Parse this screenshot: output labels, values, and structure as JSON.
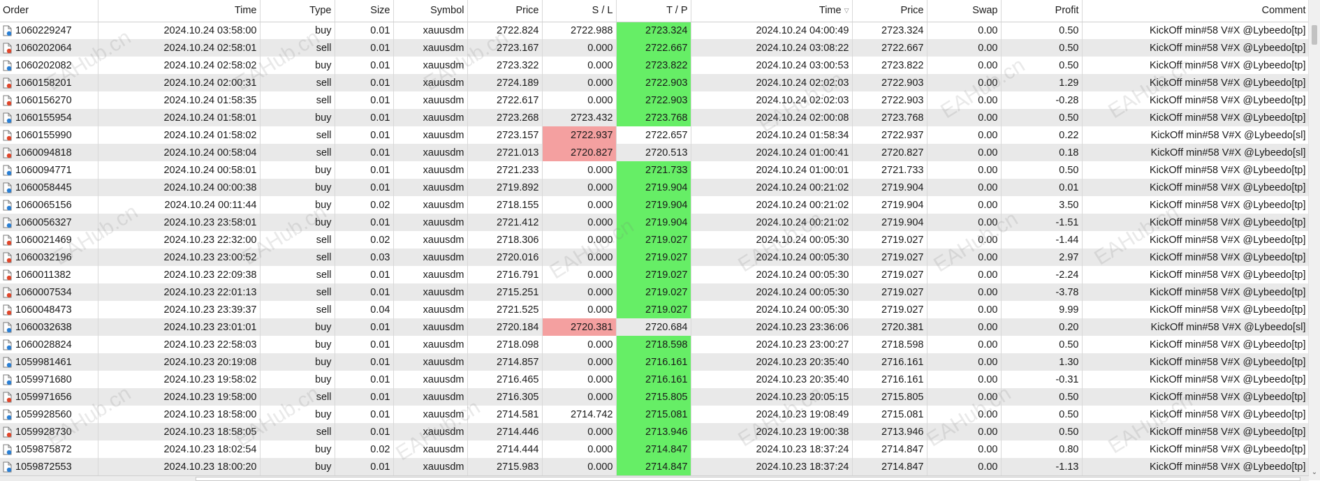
{
  "columns": [
    "Order",
    "Time",
    "Type",
    "Size",
    "Symbol",
    "Price",
    "S / L",
    "T / P",
    "Time",
    "Price",
    "Swap",
    "Profit",
    "Comment"
  ],
  "watermark_text": "EAHub.cn",
  "colors": {
    "tp_hit": "#66ee66",
    "sl_hit": "#f4a0a0",
    "row_alt": "#e9e9e9",
    "icon_buy": "#2a7fd4",
    "icon_sell": "#e0462b"
  },
  "rows": [
    {
      "order": "1060229247",
      "open_time": "2024.10.24 03:58:00",
      "type": "buy",
      "size": "0.01",
      "symbol": "xauusdm",
      "open_price": "2722.824",
      "sl": "2722.988",
      "tp": "2723.324",
      "close_time": "2024.10.24 04:00:49",
      "close_price": "2723.324",
      "swap": "0.00",
      "profit": "0.50",
      "comment": "KickOff min#58 V#X @Lybeedo[tp]",
      "hit": "tp"
    },
    {
      "order": "1060202064",
      "open_time": "2024.10.24 02:58:01",
      "type": "sell",
      "size": "0.01",
      "symbol": "xauusdm",
      "open_price": "2723.167",
      "sl": "0.000",
      "tp": "2722.667",
      "close_time": "2024.10.24 03:08:22",
      "close_price": "2722.667",
      "swap": "0.00",
      "profit": "0.50",
      "comment": "KickOff min#58 V#X @Lybeedo[tp]",
      "hit": "tp"
    },
    {
      "order": "1060202082",
      "open_time": "2024.10.24 02:58:02",
      "type": "buy",
      "size": "0.01",
      "symbol": "xauusdm",
      "open_price": "2723.322",
      "sl": "0.000",
      "tp": "2723.822",
      "close_time": "2024.10.24 03:00:53",
      "close_price": "2723.822",
      "swap": "0.00",
      "profit": "0.50",
      "comment": "KickOff min#58 V#X @Lybeedo[tp]",
      "hit": "tp"
    },
    {
      "order": "1060158201",
      "open_time": "2024.10.24 02:00:31",
      "type": "sell",
      "size": "0.01",
      "symbol": "xauusdm",
      "open_price": "2724.189",
      "sl": "0.000",
      "tp": "2722.903",
      "close_time": "2024.10.24 02:02:03",
      "close_price": "2722.903",
      "swap": "0.00",
      "profit": "1.29",
      "comment": "KickOff min#58 V#X @Lybeedo[tp]",
      "hit": "tp"
    },
    {
      "order": "1060156270",
      "open_time": "2024.10.24 01:58:35",
      "type": "sell",
      "size": "0.01",
      "symbol": "xauusdm",
      "open_price": "2722.617",
      "sl": "0.000",
      "tp": "2722.903",
      "close_time": "2024.10.24 02:02:03",
      "close_price": "2722.903",
      "swap": "0.00",
      "profit": "-0.28",
      "comment": "KickOff min#58 V#X @Lybeedo[tp]",
      "hit": "tp"
    },
    {
      "order": "1060155954",
      "open_time": "2024.10.24 01:58:01",
      "type": "buy",
      "size": "0.01",
      "symbol": "xauusdm",
      "open_price": "2723.268",
      "sl": "2723.432",
      "tp": "2723.768",
      "close_time": "2024.10.24 02:00:08",
      "close_price": "2723.768",
      "swap": "0.00",
      "profit": "0.50",
      "comment": "KickOff min#58 V#X @Lybeedo[tp]",
      "hit": "tp"
    },
    {
      "order": "1060155990",
      "open_time": "2024.10.24 01:58:02",
      "type": "sell",
      "size": "0.01",
      "symbol": "xauusdm",
      "open_price": "2723.157",
      "sl": "2722.937",
      "tp": "2722.657",
      "close_time": "2024.10.24 01:58:34",
      "close_price": "2722.937",
      "swap": "0.00",
      "profit": "0.22",
      "comment": "KickOff min#58 V#X @Lybeedo[sl]",
      "hit": "sl"
    },
    {
      "order": "1060094818",
      "open_time": "2024.10.24 00:58:04",
      "type": "sell",
      "size": "0.01",
      "symbol": "xauusdm",
      "open_price": "2721.013",
      "sl": "2720.827",
      "tp": "2720.513",
      "close_time": "2024.10.24 01:00:41",
      "close_price": "2720.827",
      "swap": "0.00",
      "profit": "0.18",
      "comment": "KickOff min#58 V#X @Lybeedo[sl]",
      "hit": "sl"
    },
    {
      "order": "1060094771",
      "open_time": "2024.10.24 00:58:01",
      "type": "buy",
      "size": "0.01",
      "symbol": "xauusdm",
      "open_price": "2721.233",
      "sl": "0.000",
      "tp": "2721.733",
      "close_time": "2024.10.24 01:00:01",
      "close_price": "2721.733",
      "swap": "0.00",
      "profit": "0.50",
      "comment": "KickOff min#58 V#X @Lybeedo[tp]",
      "hit": "tp"
    },
    {
      "order": "1060058445",
      "open_time": "2024.10.24 00:00:38",
      "type": "buy",
      "size": "0.01",
      "symbol": "xauusdm",
      "open_price": "2719.892",
      "sl": "0.000",
      "tp": "2719.904",
      "close_time": "2024.10.24 00:21:02",
      "close_price": "2719.904",
      "swap": "0.00",
      "profit": "0.01",
      "comment": "KickOff min#58 V#X @Lybeedo[tp]",
      "hit": "tp"
    },
    {
      "order": "1060065156",
      "open_time": "2024.10.24 00:11:44",
      "type": "buy",
      "size": "0.02",
      "symbol": "xauusdm",
      "open_price": "2718.155",
      "sl": "0.000",
      "tp": "2719.904",
      "close_time": "2024.10.24 00:21:02",
      "close_price": "2719.904",
      "swap": "0.00",
      "profit": "3.50",
      "comment": "KickOff min#58 V#X @Lybeedo[tp]",
      "hit": "tp"
    },
    {
      "order": "1060056327",
      "open_time": "2024.10.23 23:58:01",
      "type": "buy",
      "size": "0.01",
      "symbol": "xauusdm",
      "open_price": "2721.412",
      "sl": "0.000",
      "tp": "2719.904",
      "close_time": "2024.10.24 00:21:02",
      "close_price": "2719.904",
      "swap": "0.00",
      "profit": "-1.51",
      "comment": "KickOff min#58 V#X @Lybeedo[tp]",
      "hit": "tp"
    },
    {
      "order": "1060021469",
      "open_time": "2024.10.23 22:32:00",
      "type": "sell",
      "size": "0.02",
      "symbol": "xauusdm",
      "open_price": "2718.306",
      "sl": "0.000",
      "tp": "2719.027",
      "close_time": "2024.10.24 00:05:30",
      "close_price": "2719.027",
      "swap": "0.00",
      "profit": "-1.44",
      "comment": "KickOff min#58 V#X @Lybeedo[tp]",
      "hit": "tp"
    },
    {
      "order": "1060032196",
      "open_time": "2024.10.23 23:00:52",
      "type": "sell",
      "size": "0.03",
      "symbol": "xauusdm",
      "open_price": "2720.016",
      "sl": "0.000",
      "tp": "2719.027",
      "close_time": "2024.10.24 00:05:30",
      "close_price": "2719.027",
      "swap": "0.00",
      "profit": "2.97",
      "comment": "KickOff min#58 V#X @Lybeedo[tp]",
      "hit": "tp"
    },
    {
      "order": "1060011382",
      "open_time": "2024.10.23 22:09:38",
      "type": "sell",
      "size": "0.01",
      "symbol": "xauusdm",
      "open_price": "2716.791",
      "sl": "0.000",
      "tp": "2719.027",
      "close_time": "2024.10.24 00:05:30",
      "close_price": "2719.027",
      "swap": "0.00",
      "profit": "-2.24",
      "comment": "KickOff min#58 V#X @Lybeedo[tp]",
      "hit": "tp"
    },
    {
      "order": "1060007534",
      "open_time": "2024.10.23 22:01:13",
      "type": "sell",
      "size": "0.01",
      "symbol": "xauusdm",
      "open_price": "2715.251",
      "sl": "0.000",
      "tp": "2719.027",
      "close_time": "2024.10.24 00:05:30",
      "close_price": "2719.027",
      "swap": "0.00",
      "profit": "-3.78",
      "comment": "KickOff min#58 V#X @Lybeedo[tp]",
      "hit": "tp"
    },
    {
      "order": "1060048473",
      "open_time": "2024.10.23 23:39:37",
      "type": "sell",
      "size": "0.04",
      "symbol": "xauusdm",
      "open_price": "2721.525",
      "sl": "0.000",
      "tp": "2719.027",
      "close_time": "2024.10.24 00:05:30",
      "close_price": "2719.027",
      "swap": "0.00",
      "profit": "9.99",
      "comment": "KickOff min#58 V#X @Lybeedo[tp]",
      "hit": "tp"
    },
    {
      "order": "1060032638",
      "open_time": "2024.10.23 23:01:01",
      "type": "buy",
      "size": "0.01",
      "symbol": "xauusdm",
      "open_price": "2720.184",
      "sl": "2720.381",
      "tp": "2720.684",
      "close_time": "2024.10.23 23:36:06",
      "close_price": "2720.381",
      "swap": "0.00",
      "profit": "0.20",
      "comment": "KickOff min#58 V#X @Lybeedo[sl]",
      "hit": "sl"
    },
    {
      "order": "1060028824",
      "open_time": "2024.10.23 22:58:03",
      "type": "buy",
      "size": "0.01",
      "symbol": "xauusdm",
      "open_price": "2718.098",
      "sl": "0.000",
      "tp": "2718.598",
      "close_time": "2024.10.23 23:00:27",
      "close_price": "2718.598",
      "swap": "0.00",
      "profit": "0.50",
      "comment": "KickOff min#58 V#X @Lybeedo[tp]",
      "hit": "tp"
    },
    {
      "order": "1059981461",
      "open_time": "2024.10.23 20:19:08",
      "type": "buy",
      "size": "0.01",
      "symbol": "xauusdm",
      "open_price": "2714.857",
      "sl": "0.000",
      "tp": "2716.161",
      "close_time": "2024.10.23 20:35:40",
      "close_price": "2716.161",
      "swap": "0.00",
      "profit": "1.30",
      "comment": "KickOff min#58 V#X @Lybeedo[tp]",
      "hit": "tp"
    },
    {
      "order": "1059971680",
      "open_time": "2024.10.23 19:58:02",
      "type": "buy",
      "size": "0.01",
      "symbol": "xauusdm",
      "open_price": "2716.465",
      "sl": "0.000",
      "tp": "2716.161",
      "close_time": "2024.10.23 20:35:40",
      "close_price": "2716.161",
      "swap": "0.00",
      "profit": "-0.31",
      "comment": "KickOff min#58 V#X @Lybeedo[tp]",
      "hit": "tp"
    },
    {
      "order": "1059971656",
      "open_time": "2024.10.23 19:58:00",
      "type": "sell",
      "size": "0.01",
      "symbol": "xauusdm",
      "open_price": "2716.305",
      "sl": "0.000",
      "tp": "2715.805",
      "close_time": "2024.10.23 20:05:15",
      "close_price": "2715.805",
      "swap": "0.00",
      "profit": "0.50",
      "comment": "KickOff min#58 V#X @Lybeedo[tp]",
      "hit": "tp"
    },
    {
      "order": "1059928560",
      "open_time": "2024.10.23 18:58:00",
      "type": "buy",
      "size": "0.01",
      "symbol": "xauusdm",
      "open_price": "2714.581",
      "sl": "2714.742",
      "tp": "2715.081",
      "close_time": "2024.10.23 19:08:49",
      "close_price": "2715.081",
      "swap": "0.00",
      "profit": "0.50",
      "comment": "KickOff min#58 V#X @Lybeedo[tp]",
      "hit": "tp"
    },
    {
      "order": "1059928730",
      "open_time": "2024.10.23 18:58:05",
      "type": "sell",
      "size": "0.01",
      "symbol": "xauusdm",
      "open_price": "2714.446",
      "sl": "0.000",
      "tp": "2713.946",
      "close_time": "2024.10.23 19:00:38",
      "close_price": "2713.946",
      "swap": "0.00",
      "profit": "0.50",
      "comment": "KickOff min#58 V#X @Lybeedo[tp]",
      "hit": "tp"
    },
    {
      "order": "1059875872",
      "open_time": "2024.10.23 18:02:54",
      "type": "buy",
      "size": "0.02",
      "symbol": "xauusdm",
      "open_price": "2714.444",
      "sl": "0.000",
      "tp": "2714.847",
      "close_time": "2024.10.23 18:37:24",
      "close_price": "2714.847",
      "swap": "0.00",
      "profit": "0.80",
      "comment": "KickOff min#58 V#X @Lybeedo[tp]",
      "hit": "tp"
    },
    {
      "order": "1059872553",
      "open_time": "2024.10.23 18:00:20",
      "type": "buy",
      "size": "0.01",
      "symbol": "xauusdm",
      "open_price": "2715.983",
      "sl": "0.000",
      "tp": "2714.847",
      "close_time": "2024.10.23 18:37:24",
      "close_price": "2714.847",
      "swap": "0.00",
      "profit": "-1.13",
      "comment": "KickOff min#58 V#X @Lybeedo[tp]",
      "hit": "tp"
    }
  ]
}
